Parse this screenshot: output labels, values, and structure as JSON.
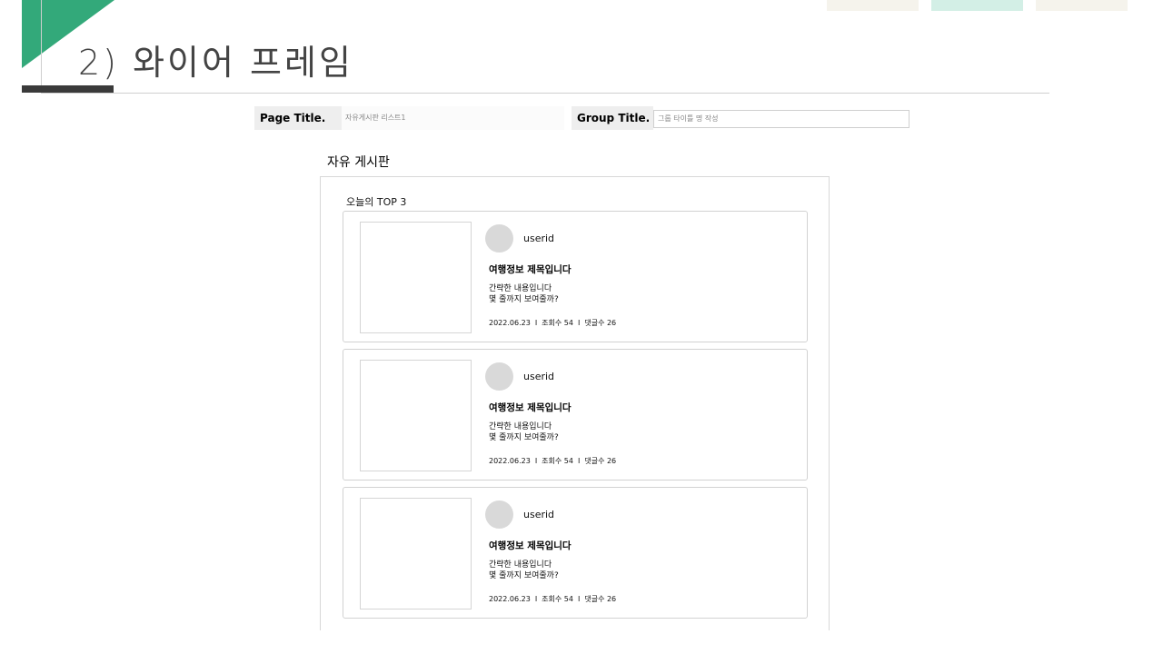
{
  "slide": {
    "title": "2) 와이어 프레임"
  },
  "colors": {
    "accent_green": "#33a97a",
    "dark_bar": "#3a3a3a",
    "tab_beige": "#f5f3ec",
    "tab_mint": "#d3efe6"
  },
  "meta": {
    "page_title_label": "Page Title.",
    "page_title_value": "자유게시판 리스트1",
    "group_title_label": "Group Title.",
    "group_title_placeholder": "그룹 타이틀 명 작성"
  },
  "board": {
    "title": "자유 게시판",
    "section_title": "오늘의 TOP 3",
    "posts": [
      {
        "userid": "userid",
        "title": "여행정보 제목입니다",
        "excerpt_line1": "간략한 내용입니다",
        "excerpt_line2": "몇 줄까지 보여줄까?",
        "date": "2022.06.23",
        "sep": "I",
        "views": "조회수 54",
        "comments": "댓글수 26"
      },
      {
        "userid": "userid",
        "title": "여행정보 제목입니다",
        "excerpt_line1": "간략한 내용입니다",
        "excerpt_line2": "몇 줄까지 보여줄까?",
        "date": "2022.06.23",
        "sep": "I",
        "views": "조회수 54",
        "comments": "댓글수 26"
      },
      {
        "userid": "userid",
        "title": "여행정보 제목입니다",
        "excerpt_line1": "간략한 내용입니다",
        "excerpt_line2": "몇 줄까지 보여줄까?",
        "date": "2022.06.23",
        "sep": "I",
        "views": "조회수 54",
        "comments": "댓글수 26"
      }
    ]
  }
}
